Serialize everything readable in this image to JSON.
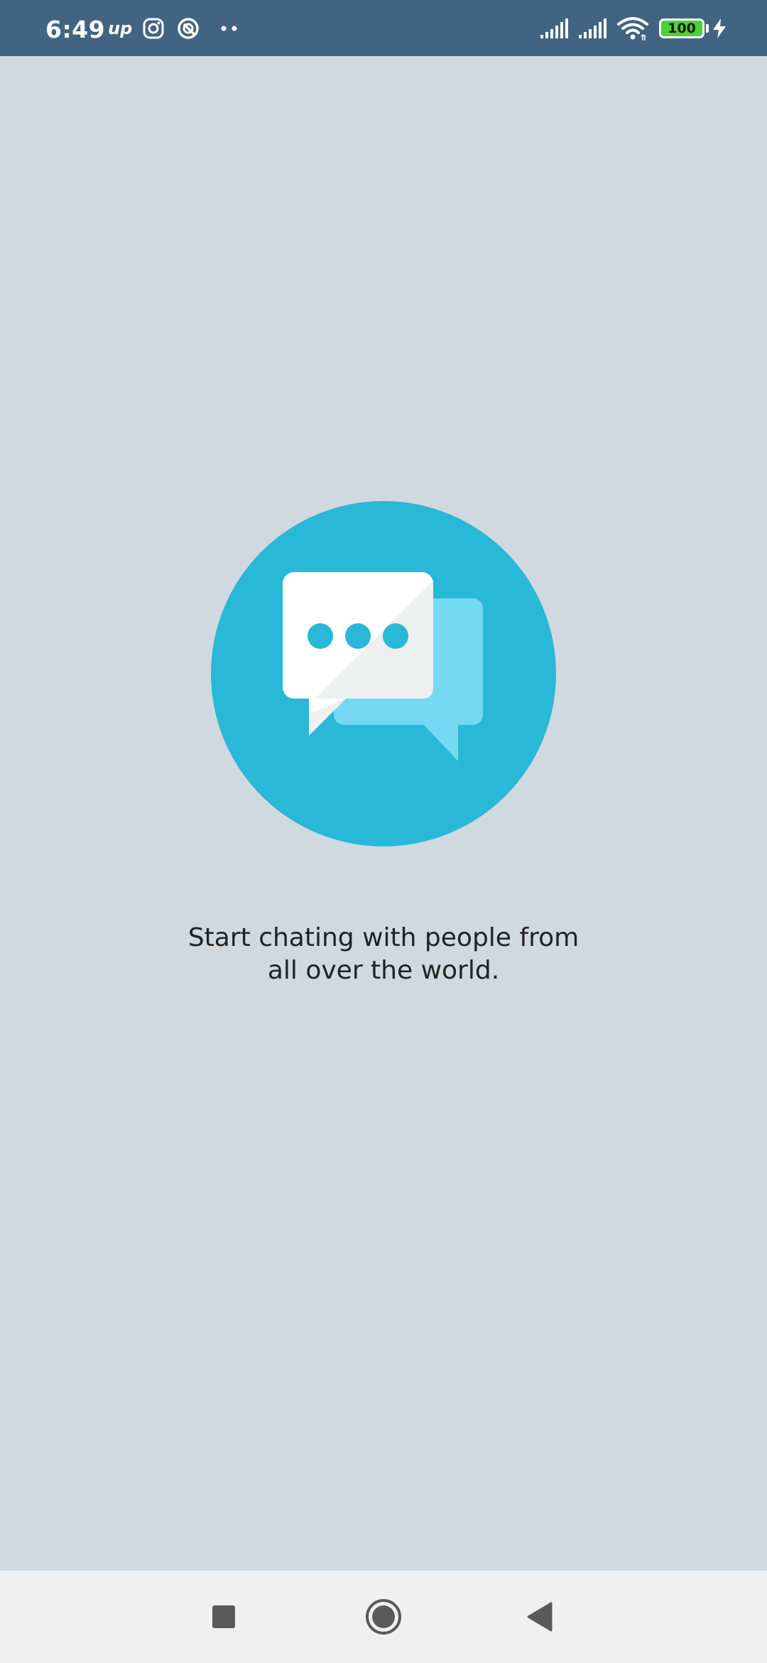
{
  "status_bar": {
    "time": "6:49",
    "up_label": "up",
    "battery_level": "100",
    "notification_icons": [
      "up-icon",
      "instagram-icon",
      "assistant-icon",
      "more-dots-icon"
    ],
    "system_icons": [
      "signal-icon",
      "signal-icon",
      "wifi-icon",
      "battery-icon",
      "charging-bolt-icon"
    ]
  },
  "main": {
    "tagline_line1": "Start chating with people from",
    "tagline_line2": "all over the world.",
    "illustration": "chat-bubbles-icon"
  },
  "nav_bar": {
    "buttons": [
      "recent-apps-icon",
      "home-icon",
      "back-icon"
    ]
  },
  "colors": {
    "status_bar_bg": "#426483",
    "page_bg": "#d1d9e0",
    "accent_circle": "#29b8d7",
    "accent_light": "#74d9f1",
    "nav_bar_bg": "#f0f0f0"
  }
}
